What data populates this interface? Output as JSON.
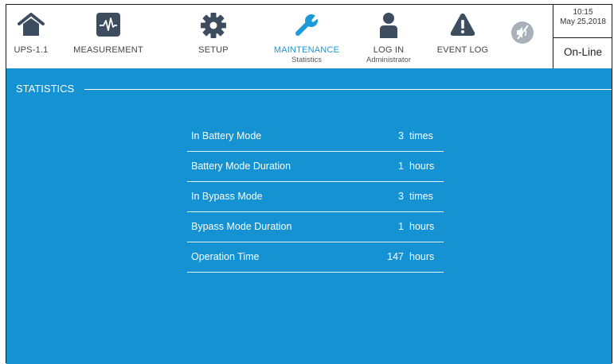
{
  "nav": {
    "items": [
      {
        "label": "UPS-1.1",
        "icon": "home-icon"
      },
      {
        "label": "MEASUREMENT",
        "icon": "waveform-icon"
      },
      {
        "label": "SETUP",
        "icon": "gear-icon"
      },
      {
        "label": "MAINTENANCE",
        "sub": "Statistics",
        "icon": "wrench-icon",
        "active": true
      },
      {
        "label": "LOG IN",
        "sub": "Administrator",
        "icon": "user-icon"
      },
      {
        "label": "EVENT LOG",
        "icon": "warning-icon"
      }
    ],
    "mute_icon": "mute-icon",
    "accent_color": "#1a9ad6"
  },
  "status": {
    "time": "10:15",
    "date": "May 25,2018",
    "mode": "On-Line"
  },
  "panel": {
    "title": "STATISTICS",
    "background": "#1592d2",
    "rows": [
      {
        "name": "In Battery Mode",
        "value": "3",
        "unit": "times"
      },
      {
        "name": "Battery Mode Duration",
        "value": "1",
        "unit": "hours"
      },
      {
        "name": "In Bypass Mode",
        "value": "3",
        "unit": "times"
      },
      {
        "name": "Bypass Mode Duration",
        "value": "1",
        "unit": "hours"
      },
      {
        "name": "Operation Time",
        "value": "147",
        "unit": "hours"
      }
    ]
  }
}
